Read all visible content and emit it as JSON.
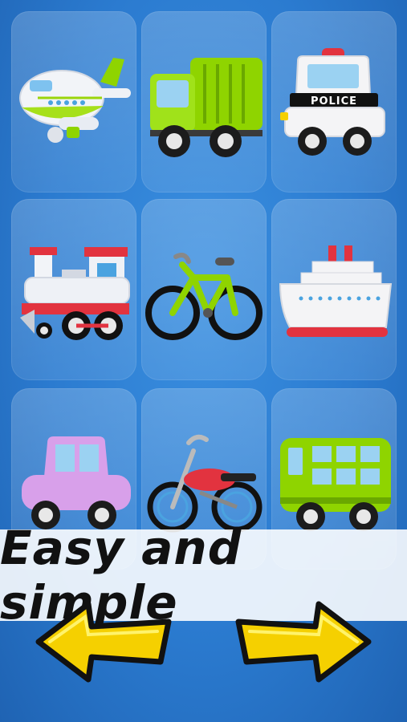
{
  "tiles": [
    {
      "name": "airplane-tile",
      "icon": "airplane-icon"
    },
    {
      "name": "garbage-truck-tile",
      "icon": "garbage-truck-icon"
    },
    {
      "name": "police-car-tile",
      "icon": "police-car-icon",
      "label": "POLICE"
    },
    {
      "name": "train-tile",
      "icon": "steam-train-icon"
    },
    {
      "name": "bicycle-tile",
      "icon": "bicycle-icon"
    },
    {
      "name": "ship-tile",
      "icon": "cruise-ship-icon"
    },
    {
      "name": "car-tile",
      "icon": "car-icon"
    },
    {
      "name": "motorcycle-tile",
      "icon": "motorcycle-icon"
    },
    {
      "name": "bus-tile",
      "icon": "bus-icon"
    }
  ],
  "banner": {
    "text": "Easy and simple"
  },
  "nav": {
    "prev_icon": "left-arrow-icon",
    "next_icon": "right-arrow-icon"
  },
  "colors": {
    "background": "#2b7bd0",
    "lime": "#8fd400",
    "red": "#e2333f",
    "arrow": "#f5d000"
  }
}
